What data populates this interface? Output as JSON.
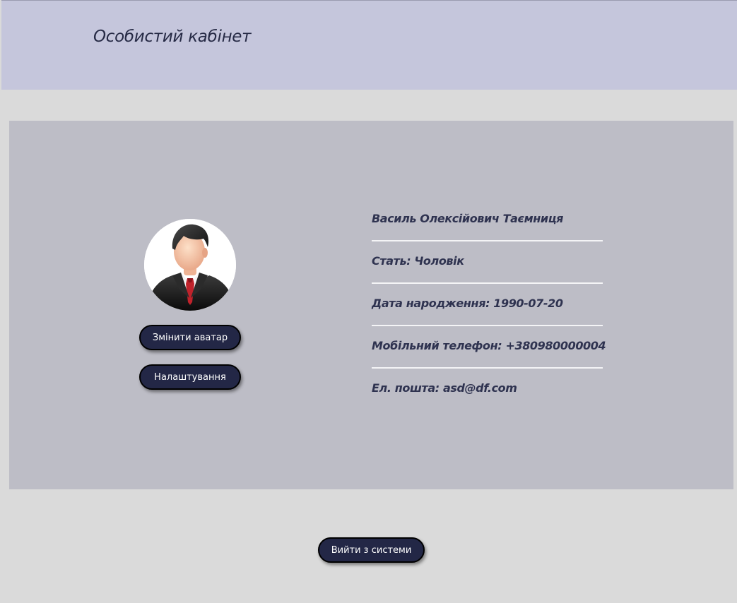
{
  "header": {
    "title": "Особистий кабінет"
  },
  "profile": {
    "avatar_icon": "businessman-avatar-icon",
    "change_avatar_label": "Змінити аватар",
    "settings_label": "Налаштування",
    "full_name": "Василь Олексійович Таємниця",
    "gender_label": "Стать:",
    "gender_value": "Чоловік",
    "birthdate_label": "Дата народження:",
    "birthdate_value": "1990-07-20",
    "phone_label": "Мобільний телефон:",
    "phone_value": "+380980000004",
    "email_label": "Ел. пошта:",
    "email_value": "asd@df.com"
  },
  "footer": {
    "logout_label": "Вийти з системи"
  },
  "colors": {
    "header_bg": "#c5c6dc",
    "page_bg": "#dadada",
    "card_bg": "#bdbdc6",
    "button_bg": "#232746",
    "text_dark": "#2f3350"
  }
}
